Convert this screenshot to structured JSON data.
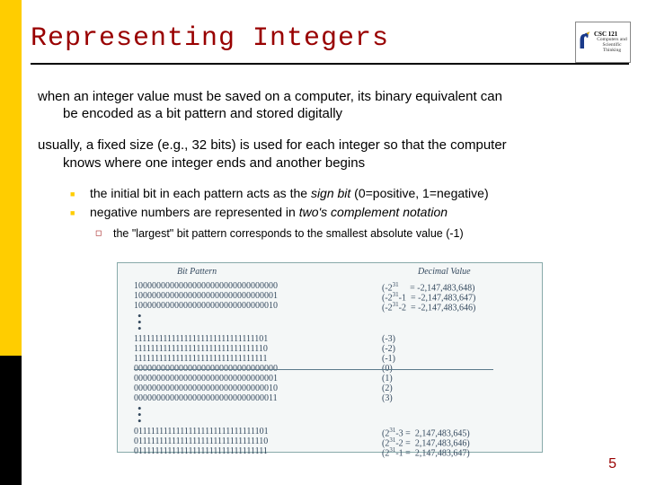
{
  "logo": {
    "course": "CSC 121",
    "subtitle": "Computers and Scientific Thinking"
  },
  "title": "Representing Integers",
  "para1_a": "when an integer value must be saved on a computer, its binary equivalent can",
  "para1_b": "be encoded as a bit pattern and stored digitally",
  "para2_a": "usually, a fixed size (e.g., 32 bits) is used for each integer so that the computer",
  "para2_b": "knows where one integer ends and another begins",
  "bullet1_a": "the initial bit in each pattern acts as the ",
  "bullet1_i": "sign bit",
  "bullet1_b": " (0=positive, 1=negative)",
  "bullet2_a": "negative numbers are represented in ",
  "bullet2_i": "two's complement notation",
  "subbullet": "the \"largest\" bit pattern corresponds to the smallest absolute value (-1)",
  "figure": {
    "h_left": "Bit Pattern",
    "h_right": "Decimal Value",
    "rows_top": [
      {
        "bits": "10000000000000000000000000000000",
        "val": "(-2³¹     = -2,147,483,648)"
      },
      {
        "bits": "10000000000000000000000000000001",
        "val": "(-2³¹-1  = -2,147,483,647)"
      },
      {
        "bits": "10000000000000000000000000000010",
        "val": "(-2³¹-2  = -2,147,483,646)"
      }
    ],
    "rows_mid": [
      {
        "bits": "11111111111111111111111111111101",
        "val": "(-3)"
      },
      {
        "bits": "11111111111111111111111111111110",
        "val": "(-2)"
      },
      {
        "bits": "11111111111111111111111111111111",
        "val": "(-1)"
      },
      {
        "bits": "00000000000000000000000000000000",
        "val": "(0)"
      },
      {
        "bits": "00000000000000000000000000000001",
        "val": "(1)"
      },
      {
        "bits": "00000000000000000000000000000010",
        "val": "(2)"
      },
      {
        "bits": "00000000000000000000000000000011",
        "val": "(3)"
      }
    ],
    "rows_bot": [
      {
        "bits": "01111111111111111111111111111101",
        "val": "(2³¹-3 =  2,147,483,645)"
      },
      {
        "bits": "01111111111111111111111111111110",
        "val": "(2³¹-2 =  2,147,483,646)"
      },
      {
        "bits": "01111111111111111111111111111111",
        "val": "(2³¹-1 =  2,147,483,647)"
      }
    ]
  },
  "page_number": "5"
}
